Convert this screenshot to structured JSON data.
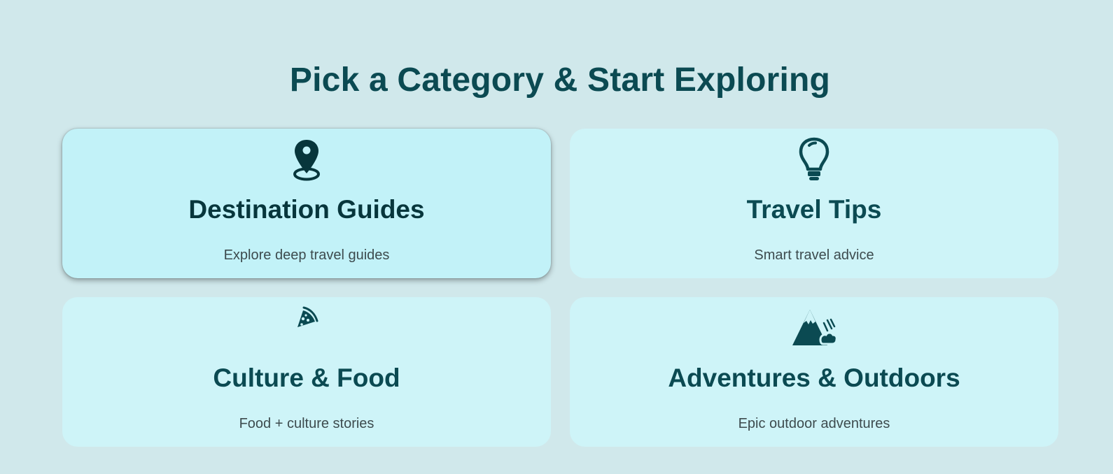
{
  "page": {
    "title": "Pick a Category & Start Exploring"
  },
  "colors": {
    "background": "#d0e8eb",
    "card": "#cef4f8",
    "card_active": "#c2f2f8",
    "heading": "#0b4a52",
    "text": "#3d4b4e"
  },
  "categories": [
    {
      "title": "Destination Guides",
      "description": "Explore deep travel guides",
      "icon": "map-pin-icon",
      "active": true
    },
    {
      "title": "Travel Tips",
      "description": "Smart travel advice",
      "icon": "lightbulb-icon",
      "active": false
    },
    {
      "title": "Culture & Food",
      "description": "Food + culture stories",
      "icon": "pizza-slice-icon",
      "active": false
    },
    {
      "title": "Adventures & Outdoors",
      "description": "Epic outdoor adventures",
      "icon": "mountain-icon",
      "active": false
    }
  ]
}
